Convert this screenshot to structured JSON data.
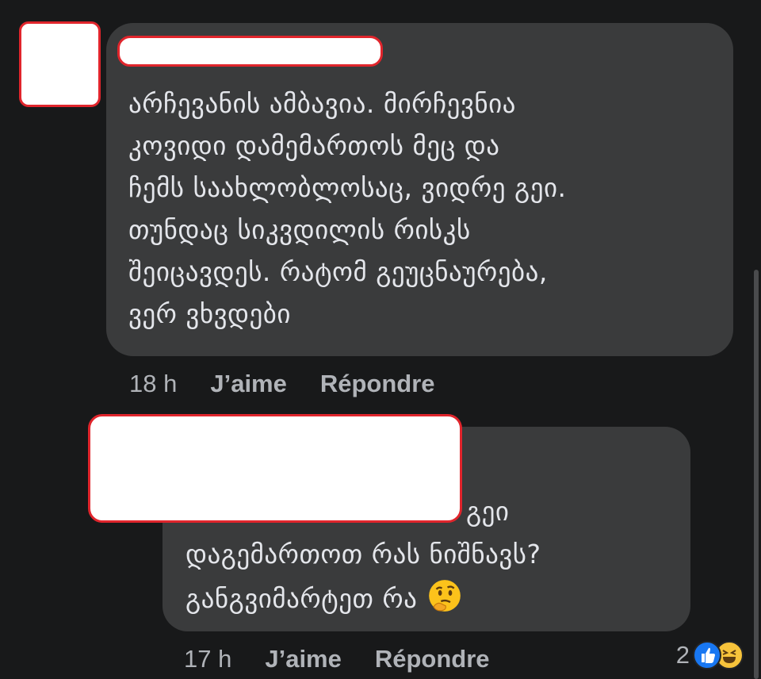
{
  "comment1": {
    "text": "არჩევანის ამბავია. მირჩევნია\nკოვიდი დამემართოს მეც და\nჩემს საახლობლოსაც, ვიდრე გეი.\nთუნდაც სიკვდილის რისკს\nშეიცავდეს. რატომ გეუცნაურება,\nვერ ვხვდები",
    "timestamp": "18 h",
    "like_label": "J’aime",
    "reply_label": "Répondre"
  },
  "comment2": {
    "line1": "გეი",
    "line2": "დაგემართოთ რას ნიშნავს?",
    "line3": "განგვიმარტეთ რა",
    "emoji": "thinking-face-icon",
    "timestamp": "17 h",
    "like_label": "J’aime",
    "reply_label": "Répondre",
    "reaction_count": "2",
    "reaction_icons": [
      "like-icon",
      "haha-icon"
    ]
  },
  "colors": {
    "background": "#18191a",
    "bubble": "#3a3b3c",
    "text": "#e4e6eb",
    "meta": "#b0b3b8",
    "redaction_border": "#e0252c",
    "like_blue": "#1877f2",
    "haha_yellow": "#f7c33b"
  }
}
